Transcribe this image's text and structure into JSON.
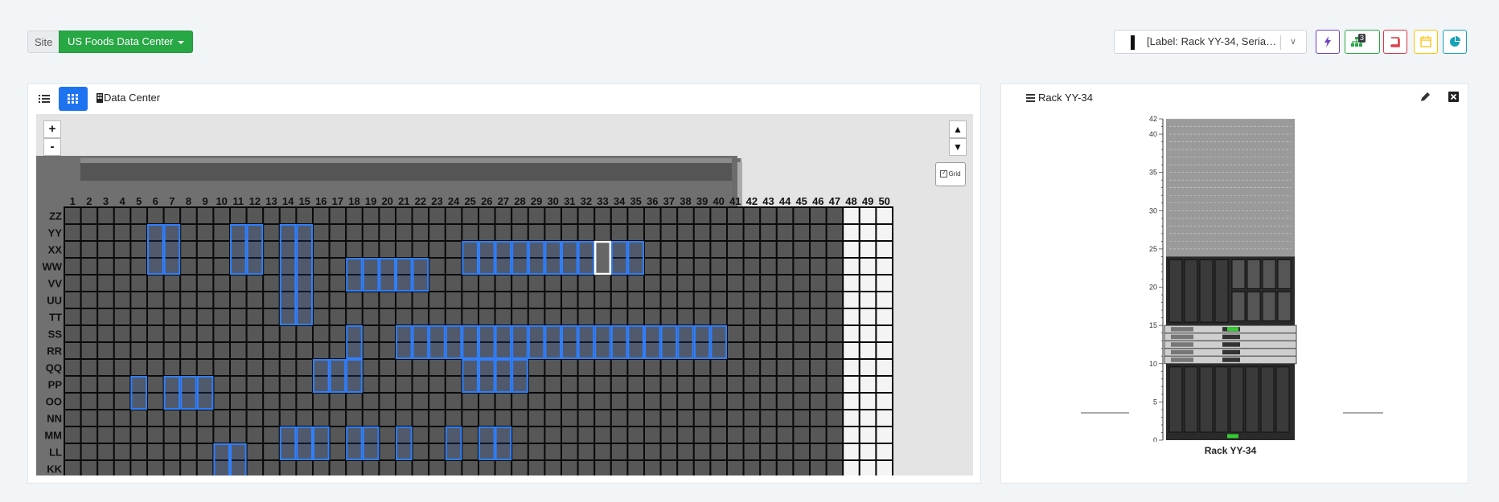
{
  "toolbar": {
    "site_label": "Site",
    "site_value": "US Foods Data Center",
    "device_select": "[Label: Rack YY-34, Serial: 2U...",
    "hierarchy_badge": "3",
    "colors": {
      "purple": "#6f42c1",
      "green": "#28a745",
      "red": "#dc3545",
      "yellow": "#ffc107",
      "teal": "#17a2b8"
    }
  },
  "floor_view": {
    "title": "Data Center",
    "zoom_in": "+",
    "zoom_out": "-",
    "pan_up": "▲",
    "pan_down": "▼",
    "grid_label": "Grid",
    "grid_checked": true,
    "columns": [
      "1",
      "2",
      "3",
      "4",
      "5",
      "6",
      "7",
      "8",
      "9",
      "10",
      "11",
      "12",
      "13",
      "14",
      "15",
      "16",
      "17",
      "18",
      "19",
      "20",
      "21",
      "22",
      "23",
      "24",
      "25",
      "26",
      "27",
      "28",
      "29",
      "30",
      "31",
      "32",
      "33",
      "34",
      "35",
      "36",
      "37",
      "38",
      "39",
      "40",
      "41",
      "42",
      "43",
      "44",
      "45",
      "46",
      "47",
      "48",
      "49",
      "50"
    ],
    "rows": [
      "ZZ",
      "YY",
      "XX",
      "WW",
      "VV",
      "UU",
      "TT",
      "SS",
      "RR",
      "QQ",
      "PP",
      "OO",
      "NN",
      "MM",
      "LL",
      "KK"
    ],
    "racks": [
      {
        "row": "YY",
        "cols": [
          6,
          7
        ],
        "span": 3
      },
      {
        "row": "YY",
        "cols": [
          11,
          12
        ],
        "span": 3
      },
      {
        "row": "YY",
        "cols": [
          14,
          15
        ],
        "span": 6
      },
      {
        "row": "XX",
        "cols": [
          25,
          26,
          27,
          28,
          29,
          30,
          31,
          32,
          33,
          34,
          35
        ],
        "span": 2
      },
      {
        "row": "WW",
        "cols": [
          18,
          19,
          20,
          21,
          22
        ],
        "span": 2
      },
      {
        "row": "SS",
        "cols": [
          18
        ],
        "span": 2
      },
      {
        "row": "SS",
        "cols": [
          21,
          22,
          23,
          24,
          25,
          26,
          27,
          28,
          29,
          30,
          31,
          32,
          33,
          34,
          35,
          36,
          37,
          38,
          39,
          40
        ],
        "span": 2
      },
      {
        "row": "QQ",
        "cols": [
          16,
          17,
          18
        ],
        "span": 2
      },
      {
        "row": "QQ",
        "cols": [
          25,
          26,
          27,
          28
        ],
        "span": 2
      },
      {
        "row": "PP",
        "cols": [
          5
        ],
        "span": 2
      },
      {
        "row": "PP",
        "cols": [
          7,
          8,
          9
        ],
        "span": 2
      },
      {
        "row": "MM",
        "cols": [
          14,
          15,
          16
        ],
        "span": 2
      },
      {
        "row": "MM",
        "cols": [
          18,
          19
        ],
        "span": 2
      },
      {
        "row": "MM",
        "cols": [
          21
        ],
        "span": 2
      },
      {
        "row": "MM",
        "cols": [
          24
        ],
        "span": 2
      },
      {
        "row": "MM",
        "cols": [
          26,
          27
        ],
        "span": 2
      },
      {
        "row": "LL",
        "cols": [
          10,
          11
        ],
        "span": 2
      }
    ],
    "selected": {
      "row": "XX",
      "col": 33
    }
  },
  "rack_view": {
    "title": "Rack YY-34",
    "rack_name": "Rack YY-34",
    "units": 42,
    "y_ticks": [
      "0",
      "5",
      "10",
      "15",
      "20",
      "25",
      "30",
      "35",
      "40",
      "42"
    ]
  }
}
